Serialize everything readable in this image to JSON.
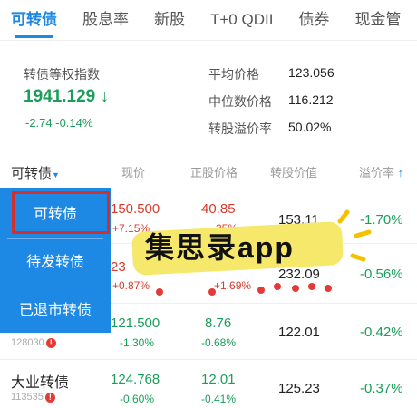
{
  "tabs": [
    "可转债",
    "股息率",
    "新股",
    "T+0 QDII",
    "债券",
    "现金管"
  ],
  "index": {
    "name": "转债等权指数",
    "value": "1941.129",
    "arrow": "↓",
    "change": "-2.74  -0.14%"
  },
  "stats": [
    {
      "label": "平均价格",
      "value": "123.056"
    },
    {
      "label": "中位数价格",
      "value": "116.212"
    },
    {
      "label": "转股溢价率",
      "value": "50.02%"
    }
  ],
  "table_headers": {
    "name": "可转债",
    "price": "现价",
    "stock_price": "正股价格",
    "conv_value": "转股价值",
    "premium": "溢价率"
  },
  "rows": [
    {
      "name": "",
      "code": "",
      "price": "150.500",
      "price_change": "+7.15%",
      "stock": "40.85",
      "stock_change": "35%",
      "conv": "153.11",
      "premium": "-1.70%"
    },
    {
      "name": "",
      "code": "",
      "price": "23",
      "price_change": "+0.87%",
      "stock": "",
      "stock_change": "+1.69%",
      "conv": "232.09",
      "premium": "-0.56%"
    },
    {
      "name": "",
      "code": "128030",
      "price": "121.500",
      "price_change": "-1.30%",
      "stock": "8.76",
      "stock_change": "-0.68%",
      "conv": "122.01",
      "premium": "-0.42%"
    },
    {
      "name": "大业转债",
      "code": "113535",
      "price": "124.768",
      "price_change": "-0.60%",
      "stock": "12.01",
      "stock_change": "-0.41%",
      "conv": "125.23",
      "premium": "-0.37%"
    }
  ],
  "dropdown": [
    "可转债",
    "待发转债",
    "已退市转债"
  ],
  "watermark": "集思录app",
  "colors": {
    "accent": "#1e88e5",
    "up": "#d93a2b",
    "down": "#1a9e5a"
  }
}
